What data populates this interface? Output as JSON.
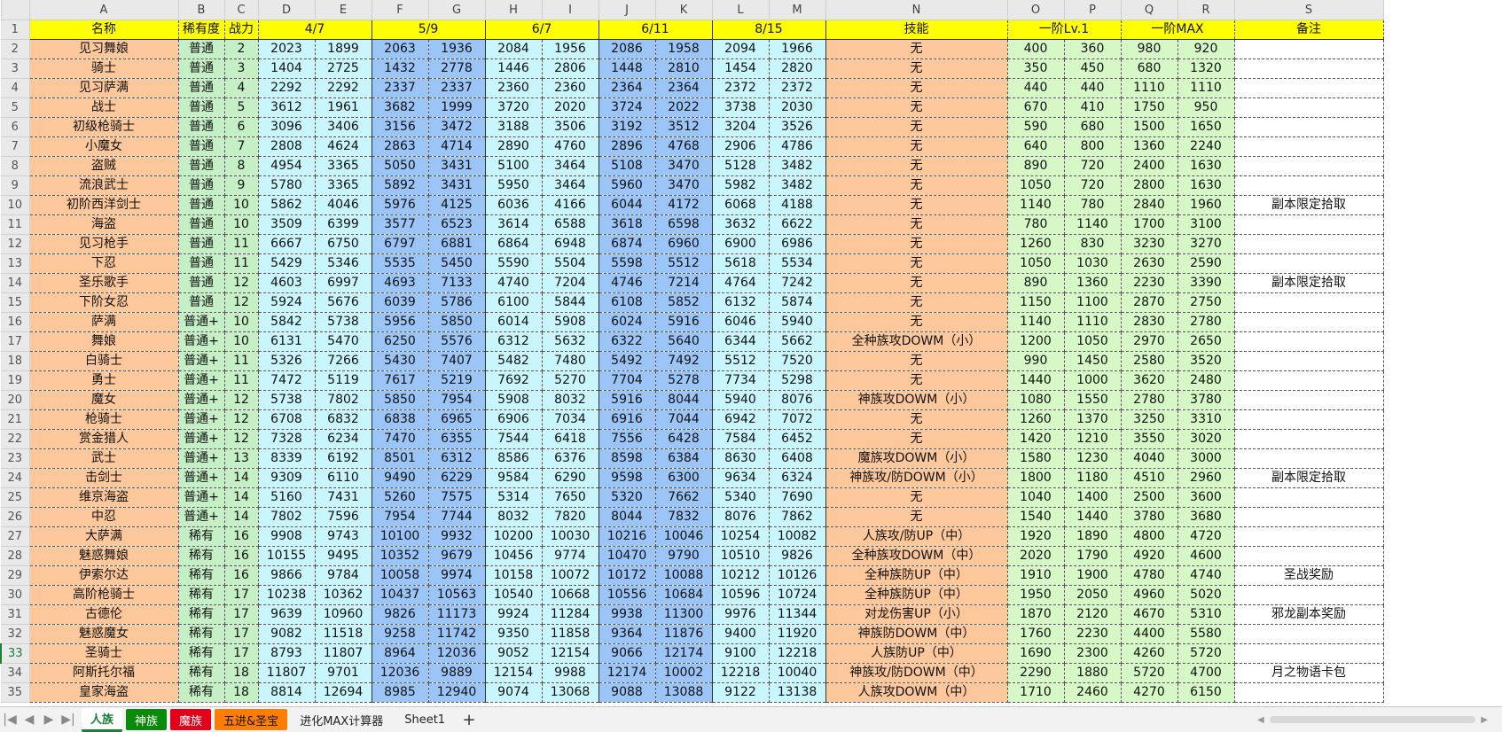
{
  "columns": [
    "A",
    "B",
    "C",
    "D",
    "E",
    "F",
    "G",
    "H",
    "I",
    "J",
    "K",
    "L",
    "M",
    "N",
    "O",
    "P",
    "Q",
    "R",
    "S"
  ],
  "headers": {
    "name": "名称",
    "rarity": "稀有度",
    "power": "战力",
    "dates": [
      "4/7",
      "5/9",
      "6/7",
      "6/11",
      "8/15"
    ],
    "skill": "技能",
    "lv1": "一阶Lv.1",
    "max": "一阶MAX",
    "note": "备注"
  },
  "rows": [
    {
      "n": "2",
      "name": "见习舞娘",
      "rar": "普通",
      "pow": "2",
      "d": [
        "2023",
        "1899",
        "2063",
        "1936",
        "2084",
        "1956",
        "2086",
        "1958",
        "2094",
        "1966"
      ],
      "skill": "无",
      "o": [
        "400",
        "360",
        "980",
        "920"
      ],
      "note": ""
    },
    {
      "n": "3",
      "name": "骑士",
      "rar": "普通",
      "pow": "3",
      "d": [
        "1404",
        "2725",
        "1432",
        "2778",
        "1446",
        "2806",
        "1448",
        "2810",
        "1454",
        "2820"
      ],
      "skill": "无",
      "o": [
        "350",
        "450",
        "680",
        "1320"
      ],
      "note": ""
    },
    {
      "n": "4",
      "name": "见习萨满",
      "rar": "普通",
      "pow": "4",
      "d": [
        "2292",
        "2292",
        "2337",
        "2337",
        "2360",
        "2360",
        "2364",
        "2364",
        "2372",
        "2372"
      ],
      "skill": "无",
      "o": [
        "440",
        "440",
        "1110",
        "1110"
      ],
      "note": ""
    },
    {
      "n": "5",
      "name": "战士",
      "rar": "普通",
      "pow": "5",
      "d": [
        "3612",
        "1961",
        "3682",
        "1999",
        "3720",
        "2020",
        "3724",
        "2022",
        "3738",
        "2030"
      ],
      "skill": "无",
      "o": [
        "670",
        "410",
        "1750",
        "950"
      ],
      "note": ""
    },
    {
      "n": "6",
      "name": "初级枪骑士",
      "rar": "普通",
      "pow": "6",
      "d": [
        "3096",
        "3406",
        "3156",
        "3472",
        "3188",
        "3506",
        "3192",
        "3512",
        "3204",
        "3526"
      ],
      "skill": "无",
      "o": [
        "590",
        "680",
        "1500",
        "1650"
      ],
      "note": ""
    },
    {
      "n": "7",
      "name": "小魔女",
      "rar": "普通",
      "pow": "7",
      "d": [
        "2808",
        "4624",
        "2863",
        "4714",
        "2890",
        "4760",
        "2896",
        "4768",
        "2906",
        "4786"
      ],
      "skill": "无",
      "o": [
        "640",
        "800",
        "1360",
        "2240"
      ],
      "note": ""
    },
    {
      "n": "8",
      "name": "盗贼",
      "rar": "普通",
      "pow": "8",
      "d": [
        "4954",
        "3365",
        "5050",
        "3431",
        "5100",
        "3464",
        "5108",
        "3470",
        "5128",
        "3482"
      ],
      "skill": "无",
      "o": [
        "890",
        "720",
        "2400",
        "1630"
      ],
      "note": ""
    },
    {
      "n": "9",
      "name": "流浪武士",
      "rar": "普通",
      "pow": "9",
      "d": [
        "5780",
        "3365",
        "5892",
        "3431",
        "5950",
        "3464",
        "5960",
        "3470",
        "5982",
        "3482"
      ],
      "skill": "无",
      "o": [
        "1050",
        "720",
        "2800",
        "1630"
      ],
      "note": ""
    },
    {
      "n": "10",
      "name": "初阶西洋剑士",
      "rar": "普通",
      "pow": "10",
      "d": [
        "5862",
        "4046",
        "5976",
        "4125",
        "6036",
        "4166",
        "6044",
        "4172",
        "6068",
        "4188"
      ],
      "skill": "无",
      "o": [
        "1140",
        "780",
        "2840",
        "1960"
      ],
      "note": "副本限定拾取"
    },
    {
      "n": "11",
      "name": "海盗",
      "rar": "普通",
      "pow": "10",
      "d": [
        "3509",
        "6399",
        "3577",
        "6523",
        "3614",
        "6588",
        "3618",
        "6598",
        "3632",
        "6622"
      ],
      "skill": "无",
      "o": [
        "780",
        "1140",
        "1700",
        "3100"
      ],
      "note": ""
    },
    {
      "n": "12",
      "name": "见习枪手",
      "rar": "普通",
      "pow": "11",
      "d": [
        "6667",
        "6750",
        "6797",
        "6881",
        "6864",
        "6948",
        "6874",
        "6960",
        "6900",
        "6986"
      ],
      "skill": "无",
      "o": [
        "1260",
        "830",
        "3230",
        "3270"
      ],
      "note": ""
    },
    {
      "n": "13",
      "name": "下忍",
      "rar": "普通",
      "pow": "11",
      "d": [
        "5429",
        "5346",
        "5535",
        "5450",
        "5590",
        "5504",
        "5598",
        "5512",
        "5618",
        "5534"
      ],
      "skill": "无",
      "o": [
        "1050",
        "1030",
        "2630",
        "2590"
      ],
      "note": ""
    },
    {
      "n": "14",
      "name": "圣乐歌手",
      "rar": "普通",
      "pow": "12",
      "d": [
        "4603",
        "6997",
        "4693",
        "7133",
        "4740",
        "7204",
        "4746",
        "7214",
        "4764",
        "7242"
      ],
      "skill": "无",
      "o": [
        "890",
        "1360",
        "2230",
        "3390"
      ],
      "note": "副本限定拾取"
    },
    {
      "n": "15",
      "name": "下阶女忍",
      "rar": "普通",
      "pow": "12",
      "d": [
        "5924",
        "5676",
        "6039",
        "5786",
        "6100",
        "5844",
        "6108",
        "5852",
        "6132",
        "5874"
      ],
      "skill": "无",
      "o": [
        "1150",
        "1100",
        "2870",
        "2750"
      ],
      "note": ""
    },
    {
      "n": "16",
      "name": "萨满",
      "rar": "普通+",
      "pow": "10",
      "d": [
        "5842",
        "5738",
        "5956",
        "5850",
        "6014",
        "5908",
        "6024",
        "5916",
        "6046",
        "5940"
      ],
      "skill": "无",
      "o": [
        "1140",
        "1110",
        "2830",
        "2780"
      ],
      "note": ""
    },
    {
      "n": "17",
      "name": "舞娘",
      "rar": "普通+",
      "pow": "10",
      "d": [
        "6131",
        "5470",
        "6250",
        "5576",
        "6312",
        "5632",
        "6322",
        "5640",
        "6344",
        "5662"
      ],
      "skill": "全种族攻DOWM（小）",
      "o": [
        "1200",
        "1050",
        "2970",
        "2650"
      ],
      "note": ""
    },
    {
      "n": "18",
      "name": "白骑士",
      "rar": "普通+",
      "pow": "11",
      "d": [
        "5326",
        "7266",
        "5430",
        "7407",
        "5482",
        "7480",
        "5492",
        "7492",
        "5512",
        "7520"
      ],
      "skill": "无",
      "o": [
        "990",
        "1450",
        "2580",
        "3520"
      ],
      "note": ""
    },
    {
      "n": "19",
      "name": "勇士",
      "rar": "普通+",
      "pow": "11",
      "d": [
        "7472",
        "5119",
        "7617",
        "5219",
        "7692",
        "5270",
        "7704",
        "5278",
        "7734",
        "5298"
      ],
      "skill": "无",
      "o": [
        "1440",
        "1000",
        "3620",
        "2480"
      ],
      "note": ""
    },
    {
      "n": "20",
      "name": "魔女",
      "rar": "普通+",
      "pow": "12",
      "d": [
        "5738",
        "7802",
        "5850",
        "7954",
        "5908",
        "8032",
        "5916",
        "8044",
        "5940",
        "8076"
      ],
      "skill": "神族攻DOWM（小）",
      "o": [
        "1080",
        "1550",
        "2780",
        "3780"
      ],
      "note": ""
    },
    {
      "n": "21",
      "name": "枪骑士",
      "rar": "普通+",
      "pow": "12",
      "d": [
        "6708",
        "6832",
        "6838",
        "6965",
        "6906",
        "7034",
        "6916",
        "7044",
        "6942",
        "7072"
      ],
      "skill": "无",
      "o": [
        "1260",
        "1370",
        "3250",
        "3310"
      ],
      "note": ""
    },
    {
      "n": "22",
      "name": "赏金猎人",
      "rar": "普通+",
      "pow": "12",
      "d": [
        "7328",
        "6234",
        "7470",
        "6355",
        "7544",
        "6418",
        "7556",
        "6428",
        "7584",
        "6452"
      ],
      "skill": "无",
      "o": [
        "1420",
        "1210",
        "3550",
        "3020"
      ],
      "note": ""
    },
    {
      "n": "23",
      "name": "武士",
      "rar": "普通+",
      "pow": "13",
      "d": [
        "8339",
        "6192",
        "8501",
        "6312",
        "8586",
        "6376",
        "8598",
        "6384",
        "8630",
        "6408"
      ],
      "skill": "魔族攻DOWM（小）",
      "o": [
        "1580",
        "1230",
        "4040",
        "3000"
      ],
      "note": ""
    },
    {
      "n": "24",
      "name": "击剑士",
      "rar": "普通+",
      "pow": "14",
      "d": [
        "9309",
        "6110",
        "9490",
        "6229",
        "9584",
        "6290",
        "9598",
        "6300",
        "9634",
        "6324"
      ],
      "skill": "神族攻/防DOWM（小）",
      "o": [
        "1800",
        "1180",
        "4510",
        "2960"
      ],
      "note": "副本限定拾取"
    },
    {
      "n": "25",
      "name": "维京海盗",
      "rar": "普通+",
      "pow": "14",
      "d": [
        "5160",
        "7431",
        "5260",
        "7575",
        "5314",
        "7650",
        "5320",
        "7662",
        "5340",
        "7690"
      ],
      "skill": "无",
      "o": [
        "1040",
        "1400",
        "2500",
        "3600"
      ],
      "note": ""
    },
    {
      "n": "26",
      "name": "中忍",
      "rar": "普通+",
      "pow": "14",
      "d": [
        "7802",
        "7596",
        "7954",
        "7744",
        "8032",
        "7820",
        "8044",
        "7832",
        "8076",
        "7862"
      ],
      "skill": "无",
      "o": [
        "1540",
        "1440",
        "3780",
        "3680"
      ],
      "note": ""
    },
    {
      "n": "27",
      "name": "大萨满",
      "rar": "稀有",
      "pow": "16",
      "d": [
        "9908",
        "9743",
        "10100",
        "9932",
        "10200",
        "10030",
        "10216",
        "10046",
        "10254",
        "10082"
      ],
      "skill": "人族攻/防UP（中）",
      "o": [
        "1920",
        "1890",
        "4800",
        "4720"
      ],
      "note": ""
    },
    {
      "n": "28",
      "name": "魅惑舞娘",
      "rar": "稀有",
      "pow": "16",
      "d": [
        "10155",
        "9495",
        "10352",
        "9679",
        "10456",
        "9774",
        "10470",
        "9790",
        "10510",
        "9826"
      ],
      "skill": "全种族攻DOWM（中）",
      "o": [
        "2020",
        "1790",
        "4920",
        "4600"
      ],
      "note": ""
    },
    {
      "n": "29",
      "name": "伊索尔达",
      "rar": "稀有",
      "pow": "16",
      "d": [
        "9866",
        "9784",
        "10058",
        "9974",
        "10158",
        "10072",
        "10172",
        "10088",
        "10212",
        "10126"
      ],
      "skill": "全种族防UP（中）",
      "o": [
        "1910",
        "1900",
        "4780",
        "4740"
      ],
      "note": "圣战奖励"
    },
    {
      "n": "30",
      "name": "高阶枪骑士",
      "rar": "稀有",
      "pow": "17",
      "d": [
        "10238",
        "10362",
        "10437",
        "10563",
        "10540",
        "10668",
        "10556",
        "10684",
        "10596",
        "10724"
      ],
      "skill": "全种族防UP（中）",
      "o": [
        "1950",
        "2050",
        "4960",
        "5020"
      ],
      "note": ""
    },
    {
      "n": "31",
      "name": "古德伦",
      "rar": "稀有",
      "pow": "17",
      "d": [
        "9639",
        "10960",
        "9826",
        "11173",
        "9924",
        "11284",
        "9938",
        "11300",
        "9976",
        "11344"
      ],
      "skill": "对龙伤害UP（小）",
      "o": [
        "1870",
        "2120",
        "4670",
        "5310"
      ],
      "note": "邪龙副本奖励"
    },
    {
      "n": "32",
      "name": "魅惑魔女",
      "rar": "稀有",
      "pow": "17",
      "d": [
        "9082",
        "11518",
        "9258",
        "11742",
        "9350",
        "11858",
        "9364",
        "11876",
        "9400",
        "11920"
      ],
      "skill": "神族防DOWM（中）",
      "o": [
        "1760",
        "2230",
        "4400",
        "5580"
      ],
      "note": ""
    },
    {
      "n": "33",
      "name": "圣骑士",
      "rar": "稀有",
      "pow": "17",
      "d": [
        "8793",
        "11807",
        "8964",
        "12036",
        "9052",
        "12154",
        "9066",
        "12174",
        "9100",
        "12218"
      ],
      "skill": "人族防UP（中）",
      "o": [
        "1690",
        "2300",
        "4260",
        "5720"
      ],
      "note": ""
    },
    {
      "n": "34",
      "name": "阿斯托尔福",
      "rar": "稀有",
      "pow": "18",
      "d": [
        "11807",
        "9701",
        "12036",
        "9889",
        "12154",
        "9988",
        "12174",
        "10002",
        "12218",
        "10040"
      ],
      "skill": "神族攻/防DOWM（中）",
      "o": [
        "2290",
        "1880",
        "5720",
        "4700"
      ],
      "note": "月之物语卡包"
    },
    {
      "n": "35",
      "name": "皇家海盗",
      "rar": "稀有",
      "pow": "18",
      "d": [
        "8814",
        "12694",
        "8985",
        "12940",
        "9074",
        "13068",
        "9088",
        "13088",
        "9122",
        "13138"
      ],
      "skill": "人族攻DOWM（中）",
      "o": [
        "1710",
        "2460",
        "4270",
        "6150"
      ],
      "note": ""
    }
  ],
  "selected_row": "33",
  "tabs": [
    {
      "label": "人族",
      "style": "active"
    },
    {
      "label": "神族",
      "style": "green"
    },
    {
      "label": "魔族",
      "style": "red"
    },
    {
      "label": "五进&圣宝",
      "style": "orange"
    },
    {
      "label": "进化MAX计算器",
      "style": ""
    },
    {
      "label": "Sheet1",
      "style": ""
    }
  ],
  "tab_add": "+",
  "nav": {
    "first": "|◀",
    "prev": "◀",
    "next": "▶",
    "last": "▶|"
  }
}
